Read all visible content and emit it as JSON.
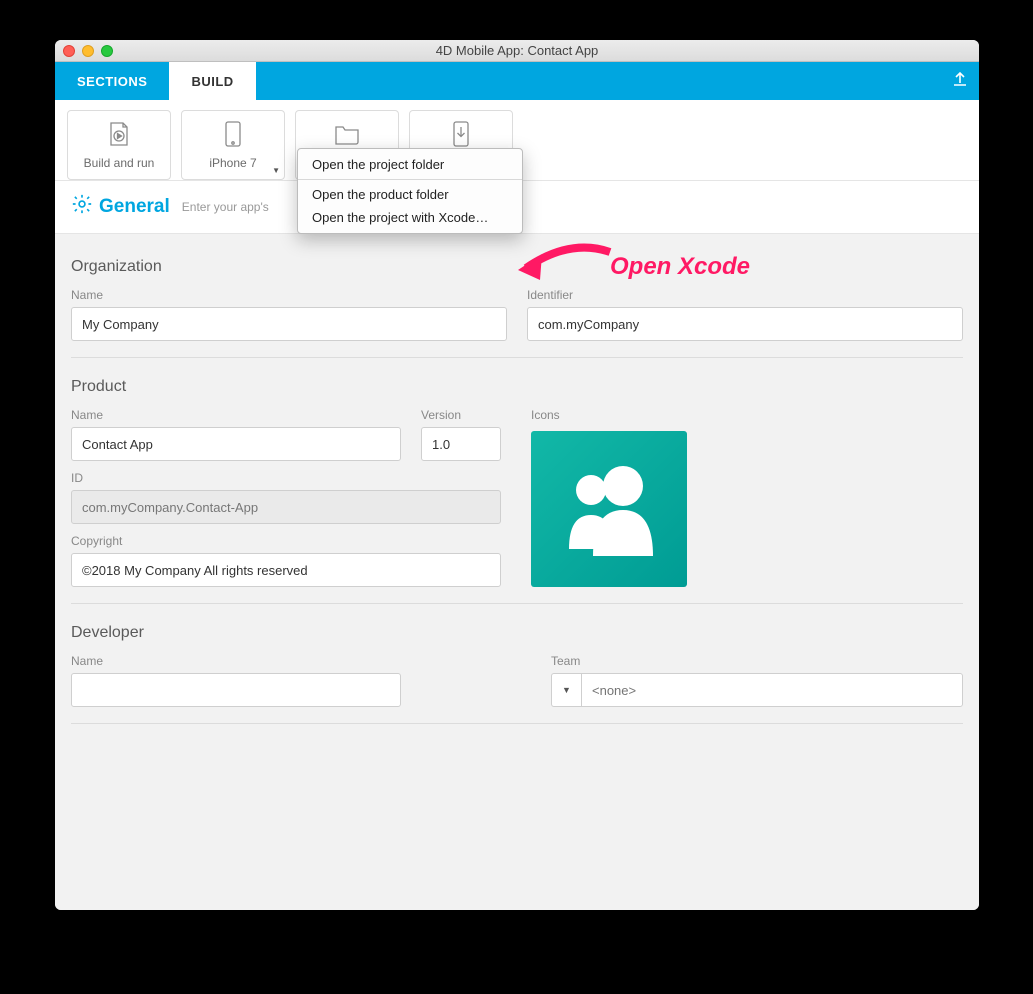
{
  "window": {
    "title": "4D Mobile App: Contact App"
  },
  "tabs": {
    "sections": "SECTIONS",
    "build": "BUILD"
  },
  "toolbar": {
    "build_run": "Build and run",
    "device": "iPhone 7",
    "project": "Project",
    "install": "Install"
  },
  "dropdown": {
    "open_project_folder": "Open the project folder",
    "open_product_folder": "Open the product folder",
    "open_with_xcode": "Open the project with Xcode…"
  },
  "section": {
    "title": "General",
    "hint": "Enter your app's"
  },
  "organization": {
    "title": "Organization",
    "name_label": "Name",
    "name_value": "My Company",
    "identifier_label": "Identifier",
    "identifier_value": "com.myCompany"
  },
  "product": {
    "title": "Product",
    "name_label": "Name",
    "name_value": "Contact App",
    "version_label": "Version",
    "version_value": "1.0",
    "icons_label": "Icons",
    "id_label": "ID",
    "id_value": "com.myCompany.Contact-App",
    "copyright_label": "Copyright",
    "copyright_value": "©2018 My Company All rights reserved"
  },
  "developer": {
    "title": "Developer",
    "name_label": "Name",
    "name_value": "",
    "team_label": "Team",
    "team_placeholder": "<none>"
  },
  "annotation": {
    "text": "Open Xcode"
  }
}
